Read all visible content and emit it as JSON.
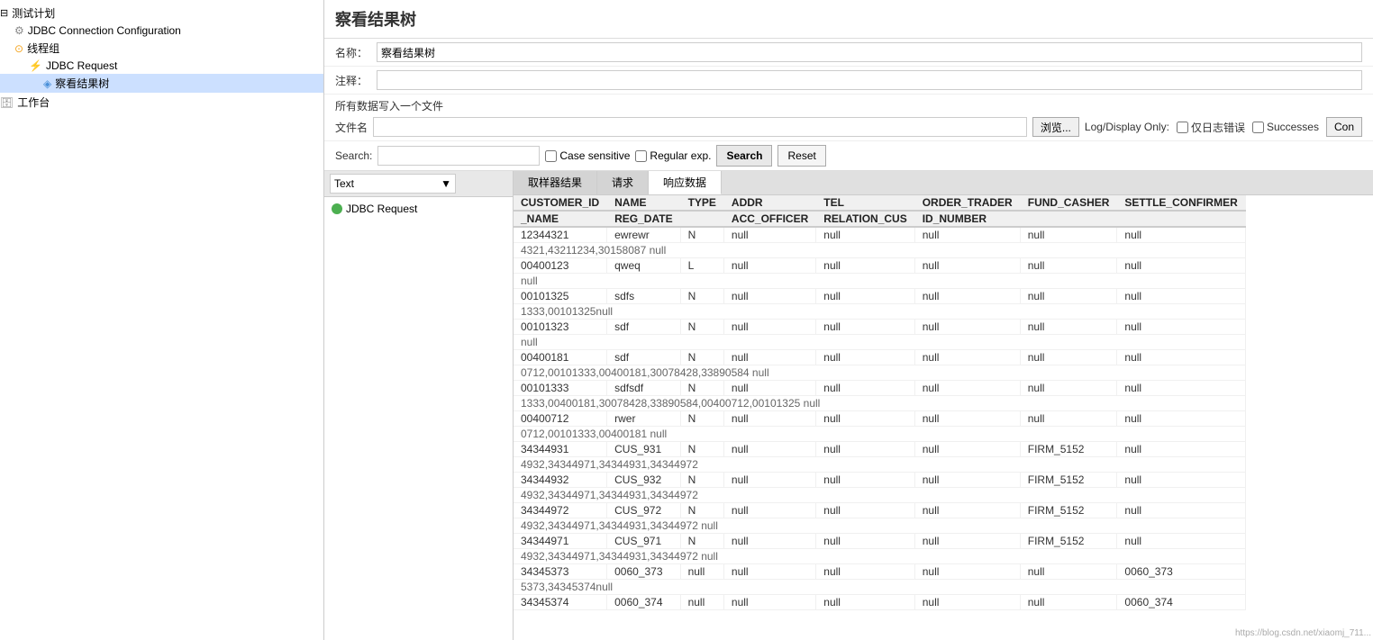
{
  "leftPanel": {
    "treeItems": [
      {
        "id": "test-plan",
        "label": "测试计划",
        "indent": 0,
        "type": "folder",
        "expanded": true
      },
      {
        "id": "jdbc-config",
        "label": "JDBC Connection Configuration",
        "indent": 1,
        "type": "wrench"
      },
      {
        "id": "thread-group",
        "label": "线程组",
        "indent": 1,
        "type": "thread",
        "expanded": true
      },
      {
        "id": "jdbc-request",
        "label": "JDBC Request",
        "indent": 2,
        "type": "request"
      },
      {
        "id": "result-tree",
        "label": "察看结果树",
        "indent": 3,
        "type": "eye",
        "selected": true
      },
      {
        "id": "workbench",
        "label": "工作台",
        "indent": 0,
        "type": "workbench"
      }
    ]
  },
  "rightPanel": {
    "title": "察看结果树",
    "nameLabel": "名称：",
    "nameValue": "察看结果树",
    "commentLabel": "注释：",
    "commentValue": "",
    "fileSectionTitle": "所有数据写入一个文件",
    "fileLabel": "文件名",
    "fileName": "",
    "browseLabel": "浏览...",
    "logDisplayLabel": "Log/Display Only:",
    "logErrLabel": "仅日志错误",
    "successLabel": "Successes",
    "configLabel": "Con",
    "searchLabel": "Search:",
    "searchValue": "",
    "caseSensitiveLabel": "Case sensitive",
    "regexpLabel": "Regular exp.",
    "searchButtonLabel": "Search",
    "resetButtonLabel": "Reset",
    "tabs": [
      {
        "id": "sampler",
        "label": "取样器结果",
        "active": false
      },
      {
        "id": "request",
        "label": "请求",
        "active": false
      },
      {
        "id": "response",
        "label": "响应数据",
        "active": true
      }
    ],
    "textDropdownLabel": "Text",
    "resultItems": [
      {
        "id": "jdbc-request-result",
        "label": "JDBC Request",
        "status": "success"
      }
    ],
    "tableHeaders": [
      "CUSTOMER_ID",
      "NAME",
      "TYPE",
      "ADDR",
      "TEL",
      "ORDER_TRADER\nID_NUMBER",
      "FUND_CASHER",
      "SETTLE_CONFIRMER"
    ],
    "tableSubHeaders": [
      "_NAME",
      "REG_DATE",
      "",
      "ACC_OFFICER",
      "RELATION_CUS",
      "",
      "",
      ""
    ],
    "tableData": [
      [
        "12344321",
        "ewrewr",
        "N",
        "null",
        "null",
        "null",
        "null",
        "null",
        "null",
        "null"
      ],
      [
        "4321,43211234,30158087",
        "",
        "null",
        "",
        "",
        "",
        "",
        "",
        "",
        ""
      ],
      [
        "00400123",
        "qweq",
        "L",
        "null",
        "null",
        "null",
        "null",
        "null",
        "null",
        "null"
      ],
      [
        "",
        "",
        "null",
        "",
        "",
        "",
        "",
        "",
        "",
        ""
      ],
      [
        "00101325",
        "sdfs",
        "N",
        "null",
        "null",
        "null",
        "null",
        "null",
        "null",
        "null"
      ],
      [
        "1333,00101325null",
        "",
        "",
        "",
        "",
        "",
        "",
        "",
        "",
        ""
      ],
      [
        "00101323",
        "sdf",
        "N",
        "null",
        "null",
        "null",
        "null",
        "null",
        "null",
        "null"
      ],
      [
        "",
        "",
        "null",
        "",
        "",
        "",
        "",
        "",
        "",
        ""
      ],
      [
        "00400181",
        "sdf",
        "N",
        "null",
        "null",
        "null",
        "null",
        "null",
        "null",
        "null"
      ],
      [
        "0712,00101333,00400181,30078428,33890584",
        "",
        "",
        "null",
        "",
        "",
        "",
        "",
        "",
        ""
      ],
      [
        "00101333",
        "sdfsdf",
        "N",
        "null",
        "null",
        "null",
        "null",
        "null",
        "null",
        "null"
      ],
      [
        "1333,00400181,30078428,33890584,00400712,00101325",
        "",
        "",
        "null",
        "",
        "",
        "",
        "",
        "",
        ""
      ],
      [
        "00400712",
        "rwer",
        "N",
        "null",
        "null",
        "null",
        "null",
        "null",
        "null",
        "null"
      ],
      [
        "0712,00101333,00400181",
        "",
        "null",
        "",
        "",
        "",
        "",
        "",
        "",
        ""
      ],
      [
        "34344931",
        "CUS_931",
        "N",
        "null",
        "null",
        "null",
        "null",
        "FIRM_5152",
        "null",
        "null"
      ],
      [
        "4932,34344971,34344931,34344972",
        "",
        "",
        "",
        "",
        "",
        "",
        "",
        "",
        ""
      ],
      [
        "34344932",
        "CUS_932",
        "N",
        "null",
        "null",
        "null",
        "null",
        "FIRM_5152",
        "null",
        "null"
      ],
      [
        "4932,34344971,34344931,34344972",
        "",
        "",
        "",
        "",
        "",
        "",
        "",
        "",
        ""
      ],
      [
        "34344972",
        "CUS_972",
        "N",
        "null",
        "null",
        "null",
        "null",
        "FIRM_5152",
        "null",
        "null"
      ],
      [
        "4932,34344971,34344931,34344972",
        "",
        "null",
        "",
        "",
        "",
        "",
        "",
        "",
        ""
      ],
      [
        "34344971",
        "CUS_971",
        "N",
        "null",
        "null",
        "null",
        "null",
        "FIRM_5152",
        "null",
        "null"
      ],
      [
        "4932,34344971,34344931,34344972",
        "",
        "null",
        "",
        "",
        "",
        "",
        "",
        "",
        ""
      ],
      [
        "34345373",
        "0060_373",
        "null",
        "null",
        "null",
        "null",
        "null",
        "null",
        "0060_373",
        "null"
      ],
      [
        "5373,34345374null",
        "",
        "",
        "",
        "",
        "",
        "",
        "",
        "",
        ""
      ],
      [
        "34345374",
        "0060_374",
        "null",
        "null",
        "null",
        "null",
        "null",
        "null",
        "0060_374",
        "null"
      ]
    ]
  },
  "watermark": "https://blog.csdn.net/xiaomj_711..."
}
